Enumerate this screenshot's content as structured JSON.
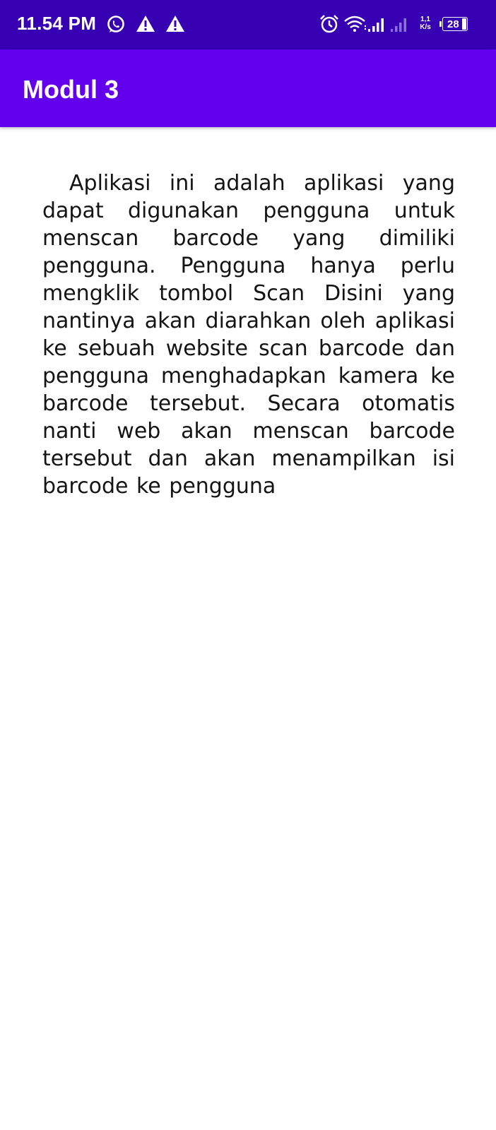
{
  "status_bar": {
    "time": "11.54 PM",
    "left_icons": [
      "whatsapp-icon",
      "warning-icon",
      "warning-icon"
    ],
    "right_icons": [
      "alarm-icon",
      "wifi-icon",
      "signal-icon",
      "signal-icon"
    ],
    "network_speed_value": "1,1",
    "network_speed_unit": "K/s",
    "battery": "28",
    "background_color": "#3700b3"
  },
  "app_bar": {
    "title": "Modul 3",
    "background_color": "#6200ee"
  },
  "content": {
    "description": "Aplikasi ini adalah aplikasi yang dapat digunakan pengguna untuk menscan barcode yang dimiliki pengguna. Pengguna hanya perlu mengklik tombol Scan Disini yang nantinya akan diarahkan oleh aplikasi ke sebuah website scan barcode dan pengguna menghadapkan kamera ke barcode tersebut. Secara otomatis nanti web akan menscan barcode tersebut dan akan menampilkan isi barcode ke pengguna"
  }
}
